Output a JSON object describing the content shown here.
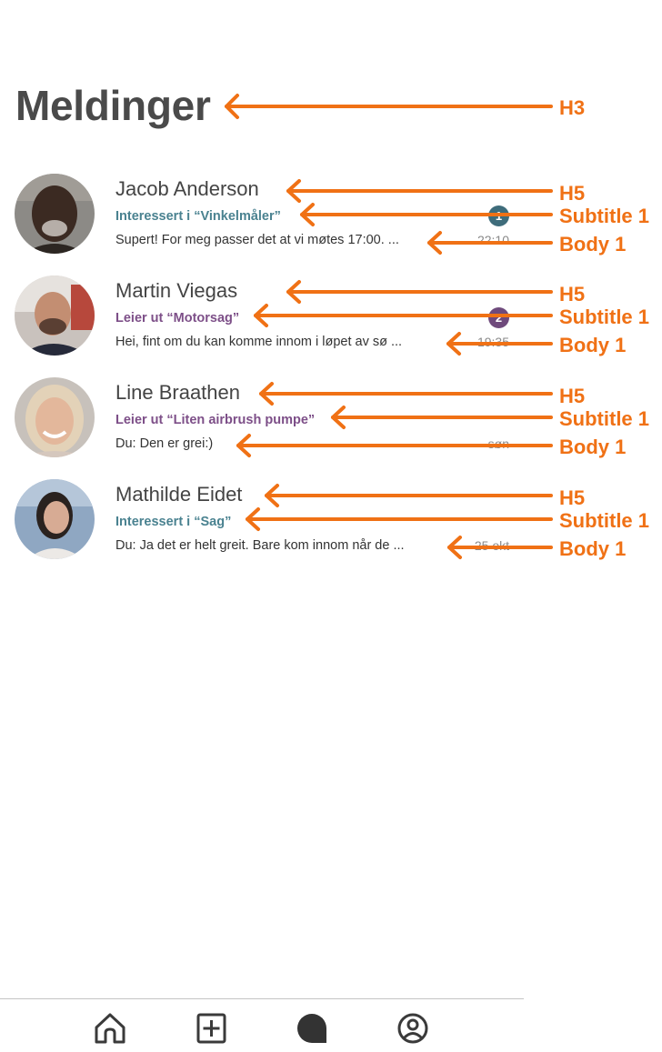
{
  "page": {
    "title": "Meldinger"
  },
  "colors": {
    "accent_teal": "#4a8290",
    "accent_purple": "#7d4f88",
    "annotation_orange": "#f07115",
    "badge_teal": "#3e6c7b",
    "badge_purple": "#6f4a7c"
  },
  "conversations": [
    {
      "name": "Jacob Anderson",
      "subtitle": "Interessert i “Vinkelmåler”",
      "subtitle_color": "#4a8290",
      "preview": "Supert! For meg passer det at vi møtes 17:00. ...",
      "time": "22:10",
      "unread": "1",
      "badge_color": "#3e6c7b"
    },
    {
      "name": "Martin Viegas",
      "subtitle": "Leier ut “Motorsag”",
      "subtitle_color": "#7d4f88",
      "preview": "Hei, fint om du kan komme innom i løpet av sø ...",
      "time": "19:35",
      "unread": "2",
      "badge_color": "#6f4a7c"
    },
    {
      "name": "Line Braathen",
      "subtitle": "Leier ut “Liten airbrush pumpe”",
      "subtitle_color": "#7d4f88",
      "preview": "Du: Den er grei:)",
      "time": "søn",
      "unread": null,
      "badge_color": null
    },
    {
      "name": "Mathilde Eidet",
      "subtitle": "Interessert i “Sag”",
      "subtitle_color": "#4a8290",
      "preview": "Du: Ja det er helt greit. Bare kom innom når de ...",
      "time": "25 okt",
      "unread": null,
      "badge_color": null
    }
  ],
  "annotations": {
    "title_label": "H3",
    "rows": [
      {
        "name_label": "H5",
        "subtitle_label": "Subtitle 1",
        "body_label": "Body 1"
      },
      {
        "name_label": "H5",
        "subtitle_label": "Subtitle 1",
        "body_label": "Body 1"
      },
      {
        "name_label": "H5",
        "subtitle_label": "Subtitle 1",
        "body_label": "Body 1"
      },
      {
        "name_label": "H5",
        "subtitle_label": "Subtitle 1",
        "body_label": "Body 1"
      }
    ]
  },
  "bottom_nav": {
    "items": [
      {
        "icon": "home-icon"
      },
      {
        "icon": "add-square-icon"
      },
      {
        "icon": "chat-bubble-icon",
        "active": true
      },
      {
        "icon": "profile-icon"
      }
    ]
  }
}
